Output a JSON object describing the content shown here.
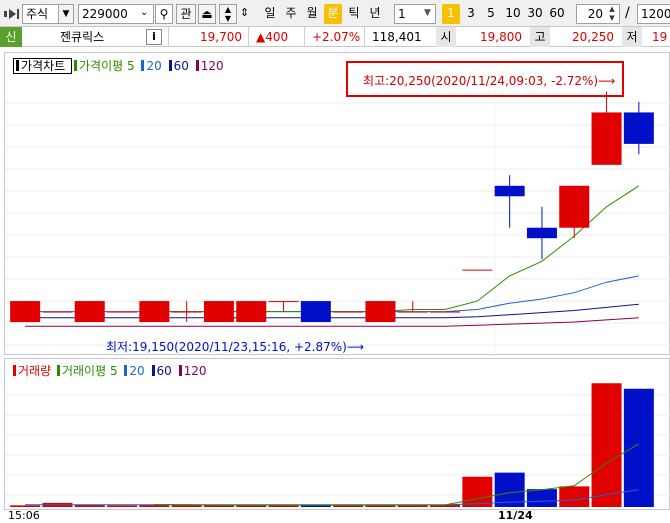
{
  "toolbar": {
    "market": "주식",
    "code": "229000",
    "gwan": "관",
    "periods": [
      "일",
      "주",
      "월",
      "분",
      "틱",
      "년"
    ],
    "active_period": "분",
    "interval": "1",
    "minutes": [
      "1",
      "3",
      "5",
      "10",
      "30",
      "60"
    ],
    "active_minute": "1",
    "count": "20",
    "divider": "/",
    "total": "1200"
  },
  "info": {
    "badge": "신",
    "name": "젠큐릭스",
    "info_btn": "i",
    "price": "19,700",
    "change": "▲400",
    "change_pct": "+2.07%",
    "volume": "118,401",
    "open_label": "시",
    "open": "19,800",
    "high_label": "고",
    "high": "20,250",
    "low_label": "저",
    "low": "19"
  },
  "price_panel": {
    "legend_title": "가격차트",
    "ma_label": "가격이평",
    "ma_periods": [
      "5",
      "20",
      "60",
      "120"
    ],
    "high_annotation": "최고:20,250(2020/11/24,09:03, -2.72%)⟶",
    "low_annotation": "최저:19,150(2020/11/23,15:16, +2.87%)⟶"
  },
  "volume_panel": {
    "legend_title": "거래량",
    "ma_label": "거래이평",
    "ma_periods": [
      "5",
      "20",
      "60",
      "120"
    ]
  },
  "time_axis": {
    "left_label": "15:06",
    "date_label": "11/24"
  },
  "colors": {
    "up": "#e00000",
    "down": "#0010c8",
    "ma5": "#2e8b00",
    "ma20": "#1e64c8",
    "ma60": "#0a148c",
    "ma120": "#8b0050"
  },
  "chart_data": {
    "type": "candlestick",
    "candles": [
      {
        "o": 19150,
        "c": 19250,
        "h": 19250,
        "l": 19150
      },
      {
        "o": 19200,
        "c": 19200,
        "h": 19200,
        "l": 19200
      },
      {
        "o": 19150,
        "c": 19250,
        "h": 19250,
        "l": 19150
      },
      {
        "o": 19200,
        "c": 19200,
        "h": 19200,
        "l": 19200
      },
      {
        "o": 19150,
        "c": 19250,
        "h": 19250,
        "l": 19150
      },
      {
        "o": 19200,
        "c": 19200,
        "h": 19250,
        "l": 19150
      },
      {
        "o": 19150,
        "c": 19250,
        "h": 19250,
        "l": 19150
      },
      {
        "o": 19150,
        "c": 19250,
        "h": 19250,
        "l": 19150
      },
      {
        "o": 19250,
        "c": 19250,
        "h": 19250,
        "l": 19200
      },
      {
        "o": 19250,
        "c": 19150,
        "h": 19250,
        "l": 19150
      },
      {
        "o": 19200,
        "c": 19200,
        "h": 19200,
        "l": 19200
      },
      {
        "o": 19150,
        "c": 19250,
        "h": 19250,
        "l": 19150
      },
      {
        "o": 19200,
        "c": 19200,
        "h": 19250,
        "l": 19200
      },
      {
        "o": 19200,
        "c": 19200,
        "h": 19200,
        "l": 19200
      },
      {
        "o": 19400,
        "c": 19400,
        "h": 19400,
        "l": 19400
      },
      {
        "o": 19800,
        "c": 19750,
        "h": 19850,
        "l": 19600
      },
      {
        "o": 19600,
        "c": 19550,
        "h": 19700,
        "l": 19450
      },
      {
        "o": 19600,
        "c": 19800,
        "h": 19800,
        "l": 19550
      },
      {
        "o": 19900,
        "c": 20150,
        "h": 20250,
        "l": 19900
      },
      {
        "o": 20150,
        "c": 20000,
        "h": 20200,
        "l": 19950
      }
    ],
    "volumes": [
      600,
      1500,
      800,
      600,
      700,
      700,
      700,
      700,
      700,
      700,
      700,
      700,
      700,
      900,
      11000,
      12500,
      6500,
      7500,
      45000,
      43000
    ],
    "ma5": [
      null,
      null,
      null,
      null,
      19200,
      19200,
      19200,
      19200,
      19200,
      19200,
      19200,
      19200,
      19210,
      19210,
      19250,
      19370,
      19440,
      19560,
      19700,
      19800
    ],
    "ma20": [
      19200,
      19200,
      19200,
      19200,
      19200,
      19200,
      19200,
      19200,
      19200,
      19200,
      19200,
      19200,
      19200,
      19200,
      19210,
      19240,
      19260,
      19290,
      19340,
      19370
    ],
    "ma60": [
      19170,
      19170,
      19170,
      19170,
      19170,
      19170,
      19170,
      19170,
      19170,
      19170,
      19170,
      19170,
      19170,
      19170,
      19175,
      19185,
      19195,
      19205,
      19220,
      19235
    ],
    "ma120": [
      19130,
      19130,
      19130,
      19130,
      19130,
      19130,
      19130,
      19130,
      19130,
      19130,
      19130,
      19130,
      19130,
      19130,
      19135,
      19140,
      19145,
      19150,
      19160,
      19170
    ],
    "vol_ma5": [
      null,
      null,
      null,
      null,
      900,
      850,
      700,
      700,
      700,
      700,
      700,
      700,
      700,
      750,
      3000,
      5200,
      6300,
      7700,
      16000,
      23000
    ],
    "vol_ma20": [
      800,
      800,
      800,
      800,
      800,
      800,
      800,
      800,
      800,
      800,
      800,
      800,
      800,
      800,
      1200,
      1800,
      2100,
      2500,
      4500,
      6300
    ],
    "ylim": [
      19050,
      20300
    ],
    "vol_ylim": [
      0,
      48000
    ]
  }
}
